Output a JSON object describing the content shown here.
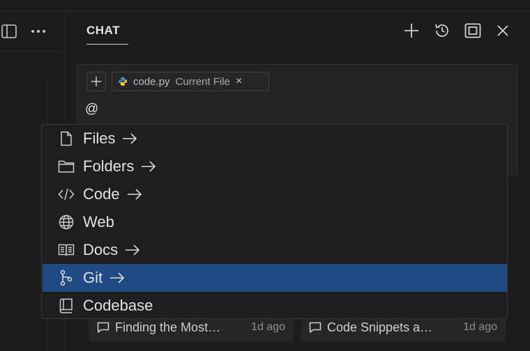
{
  "header": {
    "title": "CHAT"
  },
  "input": {
    "typed_text": "@",
    "attachment": {
      "file_name": "code.py",
      "context_label": "Current File",
      "remove_glyph": "×"
    },
    "add_glyph": "+"
  },
  "mention_menu": {
    "items": [
      {
        "label": "Files",
        "icon": "file-icon",
        "has_submenu": true
      },
      {
        "label": "Folders",
        "icon": "folder-icon",
        "has_submenu": true
      },
      {
        "label": "Code",
        "icon": "code-icon",
        "has_submenu": true
      },
      {
        "label": "Web",
        "icon": "globe-icon",
        "has_submenu": false
      },
      {
        "label": "Docs",
        "icon": "book-icon",
        "has_submenu": true
      },
      {
        "label": "Git",
        "icon": "git-branch-icon",
        "has_submenu": true,
        "selected": true
      },
      {
        "label": "Codebase",
        "icon": "repo-icon",
        "has_submenu": false
      }
    ]
  },
  "recent_chats": [
    {
      "title": "Finding the Most…",
      "ago": "1d ago"
    },
    {
      "title": "Code Snippets a…",
      "ago": "1d ago"
    }
  ],
  "colors": {
    "background": "#1c1c1e",
    "selection": "#1f4a84",
    "python_blue": "#4b8bbe",
    "python_yellow": "#ffd43b"
  }
}
